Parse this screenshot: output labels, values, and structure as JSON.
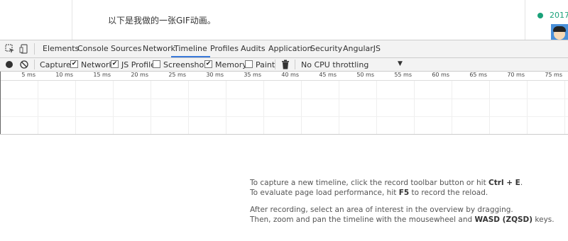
{
  "page": {
    "paragraph": "以下是我做的一张GIF动画。",
    "post_date": "2017-"
  },
  "tabs": [
    "Elements",
    "Console",
    "Sources",
    "Network",
    "Timeline",
    "Profiles",
    "Audits",
    "Application",
    "Security",
    "AngularJS"
  ],
  "active_tab": "Timeline",
  "toolbar": {
    "capture_label": "Capture:",
    "options": [
      {
        "label": "Network",
        "checked": true
      },
      {
        "label": "JS Profile",
        "checked": true
      },
      {
        "label": "Screenshots",
        "checked": false
      },
      {
        "label": "Memory",
        "checked": true
      },
      {
        "label": "Paint",
        "checked": false
      }
    ],
    "throttle_value": "No CPU throttling"
  },
  "ruler_ticks": [
    "5 ms",
    "10 ms",
    "15 ms",
    "20 ms",
    "25 ms",
    "30 ms",
    "35 ms",
    "40 ms",
    "45 ms",
    "50 ms",
    "55 ms",
    "60 ms",
    "65 ms",
    "70 ms",
    "75 ms"
  ],
  "hints": {
    "line1_prefix": "To capture a new timeline, click the record toolbar button or hit ",
    "line1_key": "Ctrl + E",
    "line1_suffix": ".",
    "line2_prefix": "To evaluate page load performance, hit ",
    "line2_key": "F5",
    "line2_suffix": " to record the reload.",
    "line3": "After recording, select an area of interest in the overview by dragging.",
    "line4_prefix": "Then, zoom and pan the timeline with the mousewheel and ",
    "line4_key": "WASD (ZQSD)",
    "line4_suffix": " keys."
  },
  "colors": {
    "accent": "#3879d9",
    "date_green": "#1aa179"
  }
}
